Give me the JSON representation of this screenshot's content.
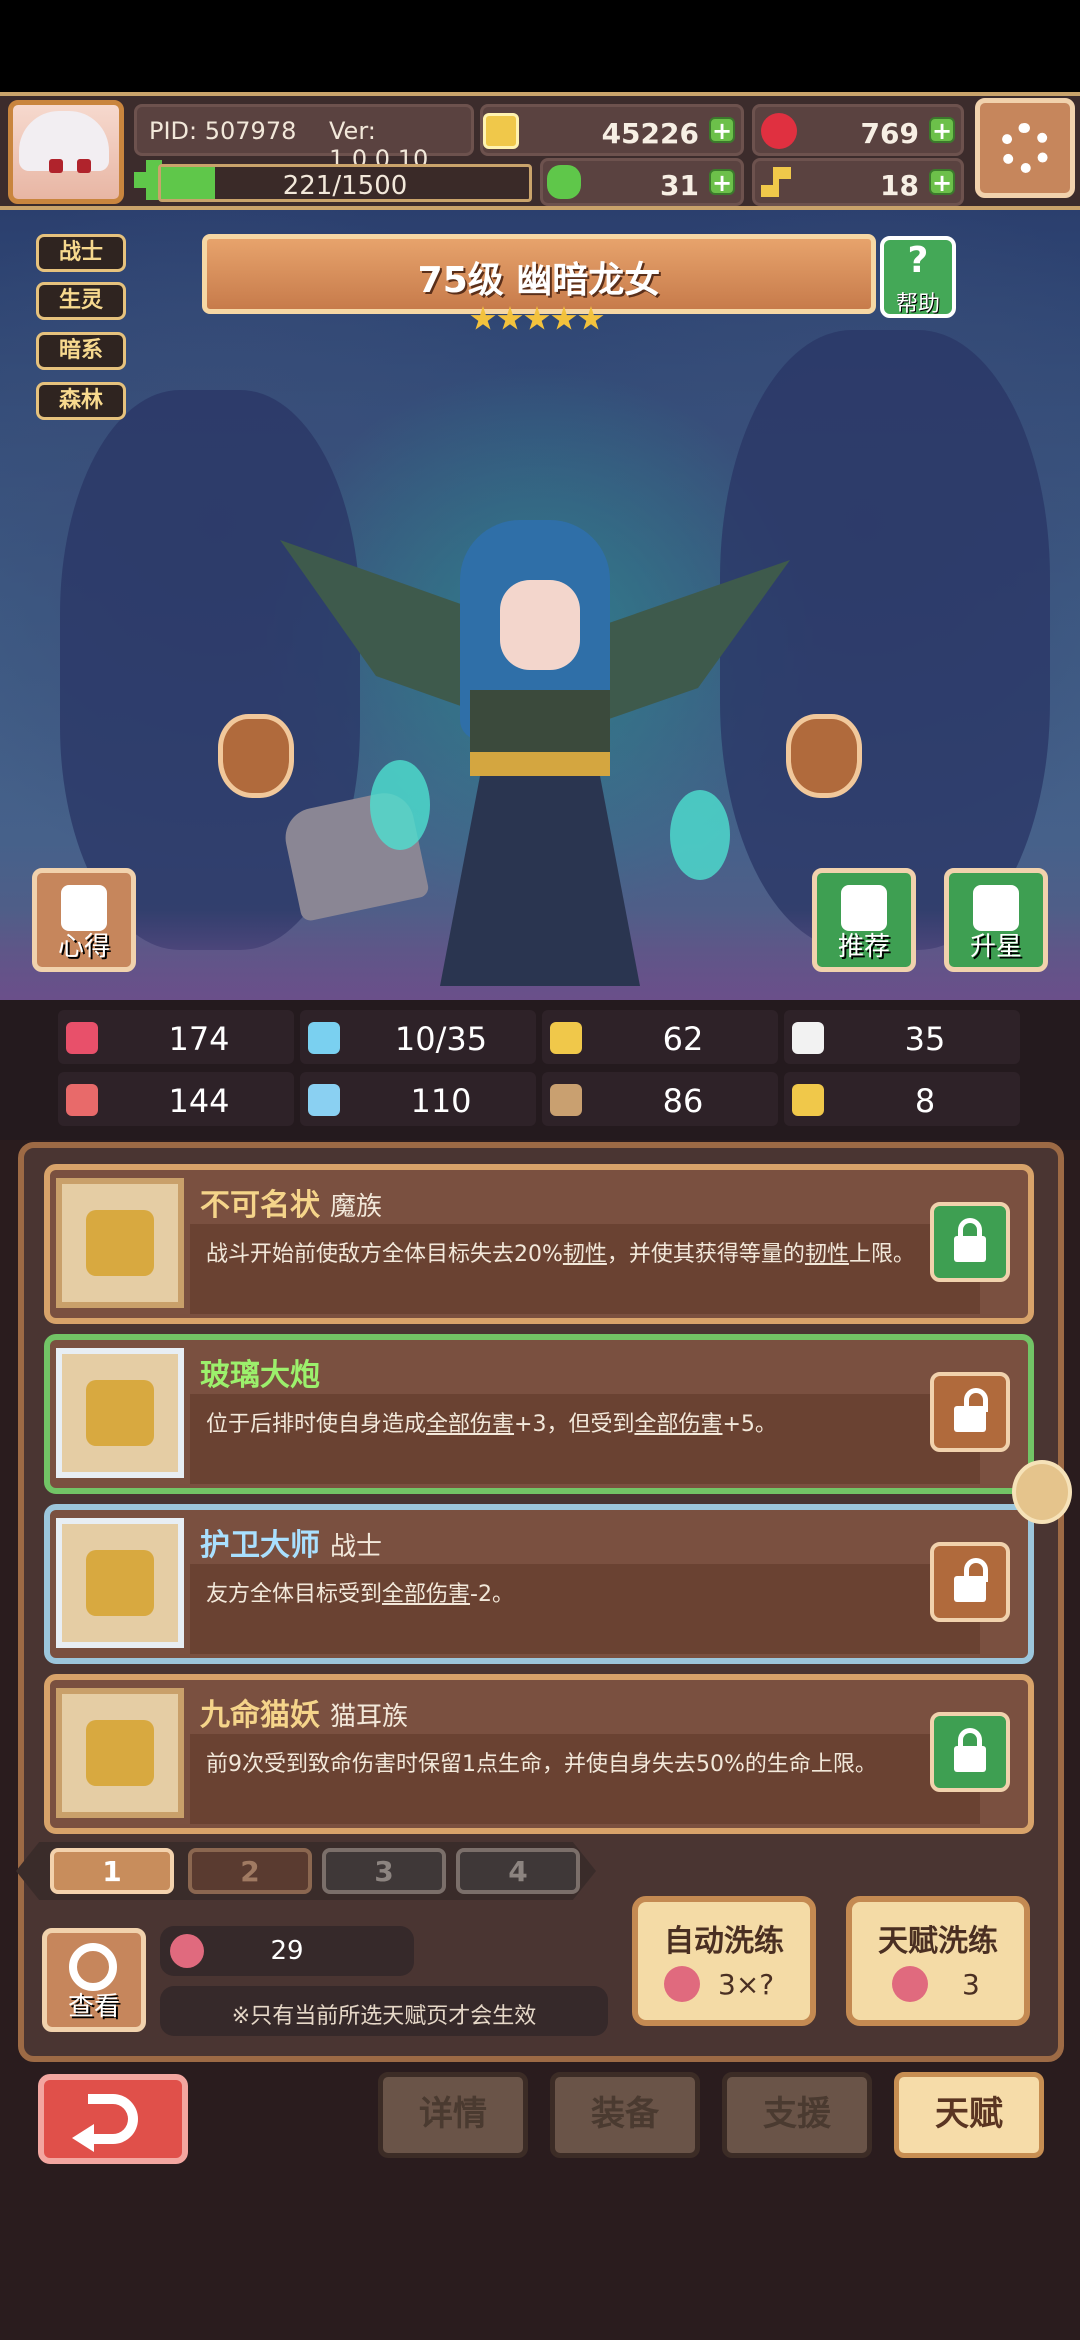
{
  "header": {
    "pid": "PID: 507978",
    "version": "Ver: 1.0.0.10",
    "gold": "45226",
    "gems": "769",
    "clover": "31",
    "key": "18",
    "exp": "221/1500",
    "exp_fraction": 0.147
  },
  "hero": {
    "tags": [
      "战士",
      "生灵",
      "暗系",
      "森林"
    ],
    "title": "75级 幽暗龙女",
    "stars": 5,
    "help_label": "帮助"
  },
  "side_buttons": {
    "notes": "心得",
    "recommend": "推荐",
    "star_up": "升星"
  },
  "stats": [
    {
      "icon": "heart-icon",
      "value": "174",
      "color": "#e8506a"
    },
    {
      "icon": "water-drop-icon",
      "value": "10/35",
      "color": "#7ad0f0"
    },
    {
      "icon": "shield-icon",
      "value": "62",
      "color": "#f0c84a"
    },
    {
      "icon": "wing-icon",
      "value": "35",
      "color": "#f2f2f2"
    },
    {
      "icon": "fist-icon",
      "value": "144",
      "color": "#e86a6a"
    },
    {
      "icon": "book-icon",
      "value": "110",
      "color": "#8ad0f2"
    },
    {
      "icon": "scroll-icon",
      "value": "86",
      "color": "#c9a070"
    },
    {
      "icon": "horseshoe-icon",
      "value": "8",
      "color": "#f0c84a"
    }
  ],
  "talents": [
    {
      "name": "不可名状",
      "sub": "魔族",
      "desc_parts": [
        "战斗开始前使敌方全体目标失去20%",
        "韧性",
        "，并使其获得等量的",
        "韧性",
        "上限。"
      ],
      "locked": true,
      "style": "brown"
    },
    {
      "name": "玻璃大炮",
      "sub": "",
      "desc_parts": [
        "位于后排时使自身造成",
        "全部伤害",
        "+3，但受到",
        "全部伤害",
        "+5。"
      ],
      "locked": false,
      "style": "green"
    },
    {
      "name": "护卫大师",
      "sub": "战士",
      "desc_parts": [
        "友方全体目标受到",
        "全部伤害",
        "-2。"
      ],
      "locked": false,
      "style": "blue"
    },
    {
      "name": "九命猫妖",
      "sub": "猫耳族",
      "desc_parts": [
        "前9次受到致命伤害时保留1点生命，并使自身失去50%的生命上限。"
      ],
      "locked": true,
      "style": "brown"
    }
  ],
  "pages": [
    "1",
    "2",
    "3",
    "4"
  ],
  "bottom_panel": {
    "view_label": "查看",
    "fruit_count": "29",
    "note": "※只有当前所选天赋页才会生效",
    "auto_reroll": {
      "label": "自动洗练",
      "cost": "3×?"
    },
    "talent_reroll": {
      "label": "天赋洗练",
      "cost": "3"
    }
  },
  "nav": [
    "详情",
    "装备",
    "支援",
    "天赋"
  ]
}
